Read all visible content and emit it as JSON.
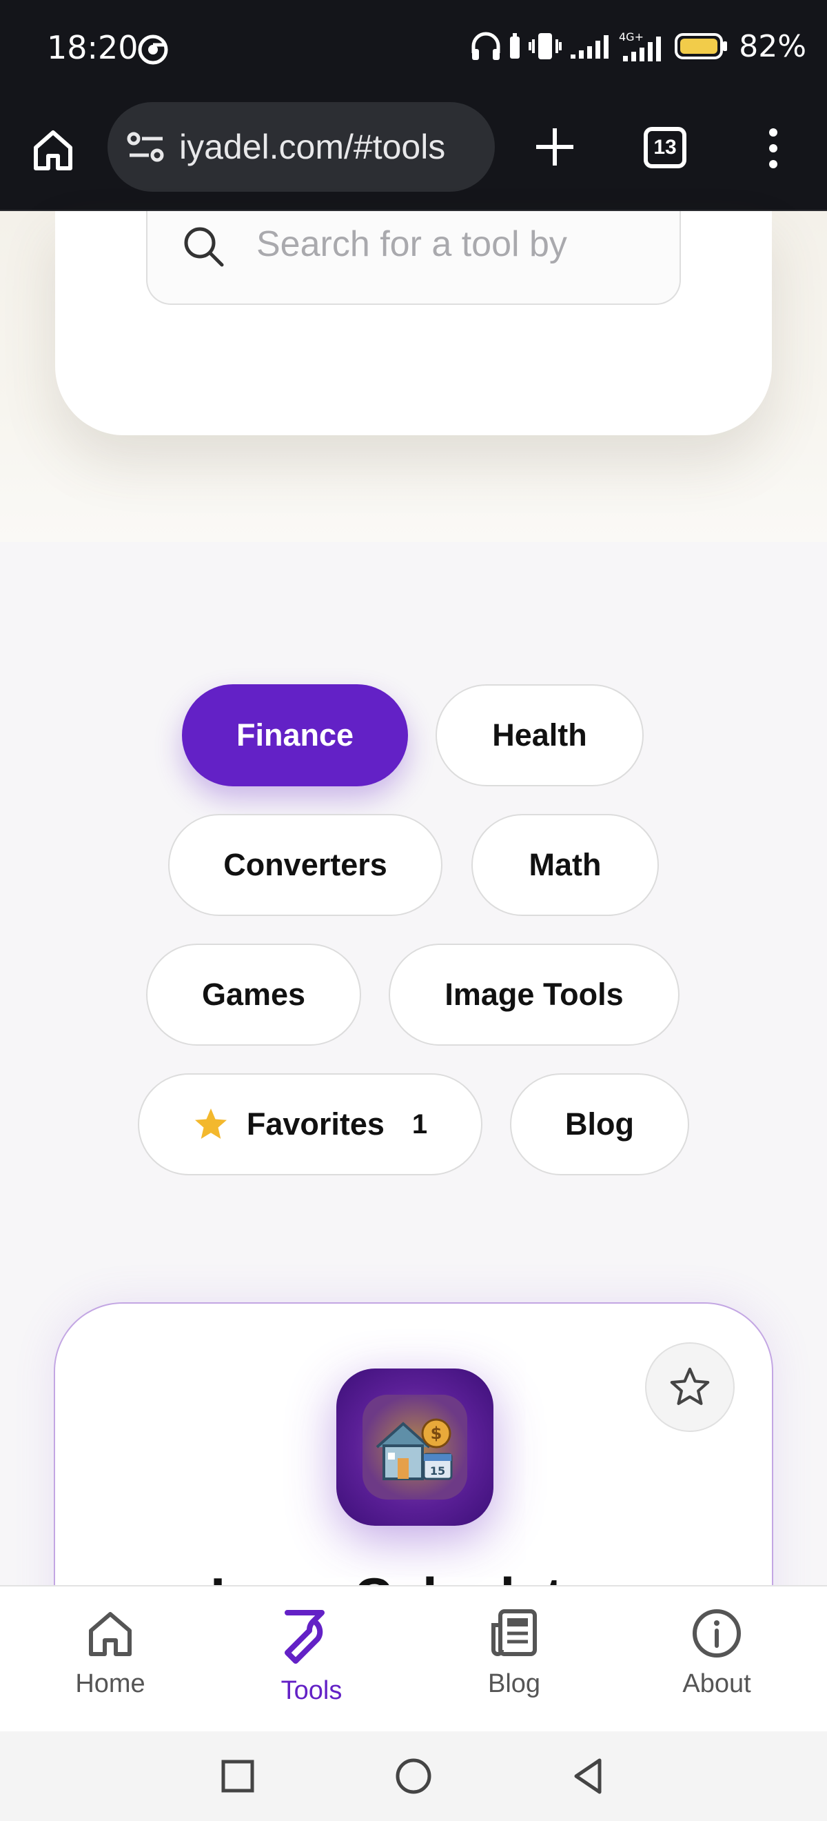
{
  "status_bar": {
    "time": "18:20",
    "battery": "82%",
    "network": "4G+"
  },
  "browser": {
    "url": "iyadel.com/#tools",
    "tab_count": "13"
  },
  "search": {
    "placeholder": "Search for a tool by"
  },
  "categories": [
    {
      "label": "Finance",
      "active": true
    },
    {
      "label": "Health",
      "active": false
    },
    {
      "label": "Converters",
      "active": false
    },
    {
      "label": "Math",
      "active": false
    },
    {
      "label": "Games",
      "active": false
    },
    {
      "label": "Image Tools",
      "active": false
    },
    {
      "label": "Favorites",
      "count": "1",
      "active": false
    },
    {
      "label": "Blog",
      "active": false
    }
  ],
  "tool_card": {
    "title": "Loan Calculator",
    "icon": "house-loan-icon"
  },
  "bottom_nav": [
    {
      "label": "Home",
      "icon": "home-icon",
      "active": false
    },
    {
      "label": "Tools",
      "icon": "wrench-icon",
      "active": true
    },
    {
      "label": "Blog",
      "icon": "newspaper-icon",
      "active": false
    },
    {
      "label": "About",
      "icon": "info-icon",
      "active": false
    }
  ],
  "colors": {
    "accent": "#6321c6",
    "favorite_star": "#f3b82d"
  }
}
